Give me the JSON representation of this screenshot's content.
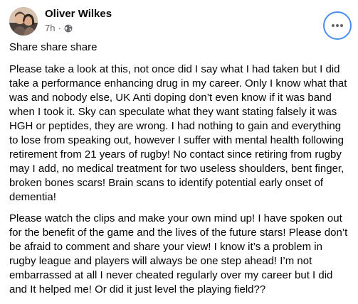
{
  "post": {
    "author": "Oliver Wilkes",
    "time": "7h",
    "separator": "·",
    "privacy_icon": "globe-icon",
    "more_icon": "more-horizontal-icon",
    "paragraphs": [
      "Share share share",
      "Please take a look at this, not once did I say what I had taken but I did take a performance enhancing drug in my career. Only I know what that was and nobody else, UK Anti doping don’t even know if it was band when I took it. Sky can speculate what they want stating falsely it was HGH or peptides, they are wrong. I had nothing to gain and everything to lose from speaking out, however I suffer with mental health following retirement from 21 years of rugby! No contact since retiring from rugby may I add, no medical treatment for two useless shoulders, bent finger, broken bones scars! Brain scans to identify potential early onset of dementia!",
      "Please watch the clips and make your own mind up! I have spoken out for the benefit of the game and the lives of the future stars! Please don’t be afraid to comment and share your view! I know it’s a problem in rugby league and players will always be one step ahead! I’m not embarrassed at all I never cheated regularly over my career but I did and It helped me! Or did it just level the playing field??"
    ]
  },
  "colors": {
    "text": "#050505",
    "secondary_text": "#65676b",
    "focus_ring": "#4a8ff0",
    "background": "#ffffff"
  }
}
